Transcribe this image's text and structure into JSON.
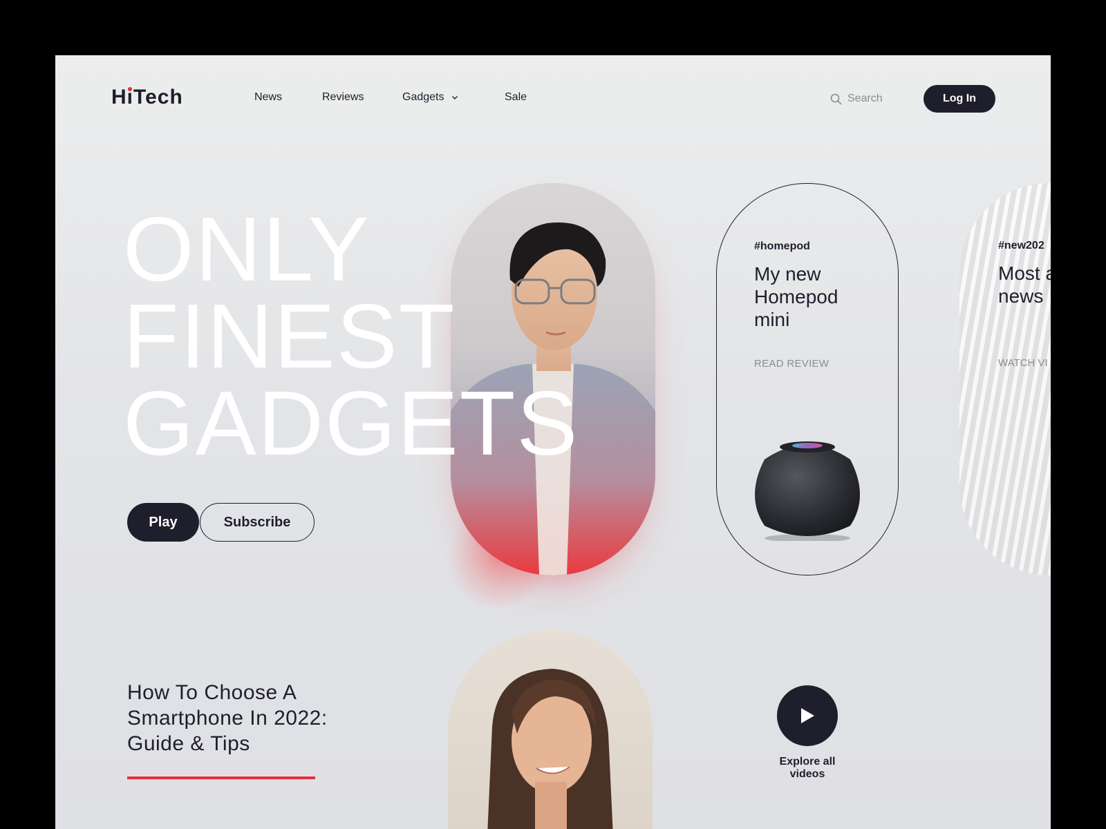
{
  "brand": {
    "logo_text_left": "H",
    "logo_text_i": "i",
    "logo_text_right": "Tech"
  },
  "nav": {
    "items": [
      {
        "label": "News"
      },
      {
        "label": "Reviews"
      },
      {
        "label": "Gadgets",
        "has_dropdown": true
      },
      {
        "label": "Sale"
      }
    ]
  },
  "search": {
    "placeholder": "Search",
    "icon": "search-icon"
  },
  "login": {
    "label": "Log In"
  },
  "hero": {
    "title_lines": [
      "ONLY",
      "FINEST",
      "GADGETS"
    ],
    "play_label": "Play",
    "subscribe_label": "Subscribe"
  },
  "cards": [
    {
      "tag": "#homepod",
      "title": "My new Homepod mini",
      "link": "READ REVIEW"
    },
    {
      "tag": "#new202",
      "title": "Most anticip news",
      "link": "WATCH VI"
    }
  ],
  "article": {
    "title": "How To Choose A Smartphone In 2022: Guide & Tips"
  },
  "videos": {
    "label": "Explore all videos",
    "icon": "play-icon"
  },
  "colors": {
    "dark": "#1f1e2c",
    "accent": "#e5303d",
    "muted": "#8a8c93"
  }
}
